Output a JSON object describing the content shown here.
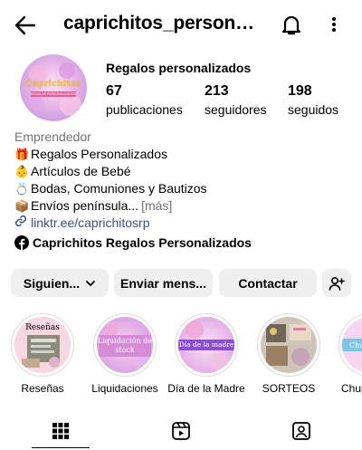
{
  "header": {
    "username": "caprichitos_personalizados"
  },
  "profile": {
    "avatar_title": "Caprichitos",
    "avatar_subtitle": "REGALOS PERSONALIZADOS",
    "display_name": "Regalos personalizados",
    "stats": [
      {
        "value": "67",
        "label": "publicaciones"
      },
      {
        "value": "213",
        "label": "seguidores"
      },
      {
        "value": "198",
        "label": "seguidos"
      }
    ]
  },
  "bio": {
    "category": "Emprendedor",
    "lines": [
      {
        "emoji": "🎁",
        "text": "Regalos Personalizados"
      },
      {
        "emoji": "👶",
        "text": "Artículos de Bebé"
      },
      {
        "emoji": "💍",
        "text": "Bodas, Comuniones y Bautizos"
      },
      {
        "emoji": "📦",
        "text": "Envíos península..."
      }
    ],
    "more": "[más]",
    "link": "linktr.ee/caprichitosrp",
    "facebook_page": "Caprichitos Regalos Personalizados"
  },
  "actions": {
    "following": "Siguien...",
    "message": "Enviar mens...",
    "contact": "Contactar"
  },
  "highlights": [
    {
      "label": "Reseñas",
      "cover_text": "Reseñas"
    },
    {
      "label": "Liquidaciones",
      "cover_text": "Liquidación de stock"
    },
    {
      "label": "Día de la Madre",
      "cover_text": "Día de la madre"
    },
    {
      "label": "SORTEOS",
      "cover_text": ""
    },
    {
      "label": "Chupe",
      "cover_text": "Chu"
    }
  ],
  "tabs": [
    "grid-icon",
    "reels-icon",
    "tagged-icon"
  ]
}
